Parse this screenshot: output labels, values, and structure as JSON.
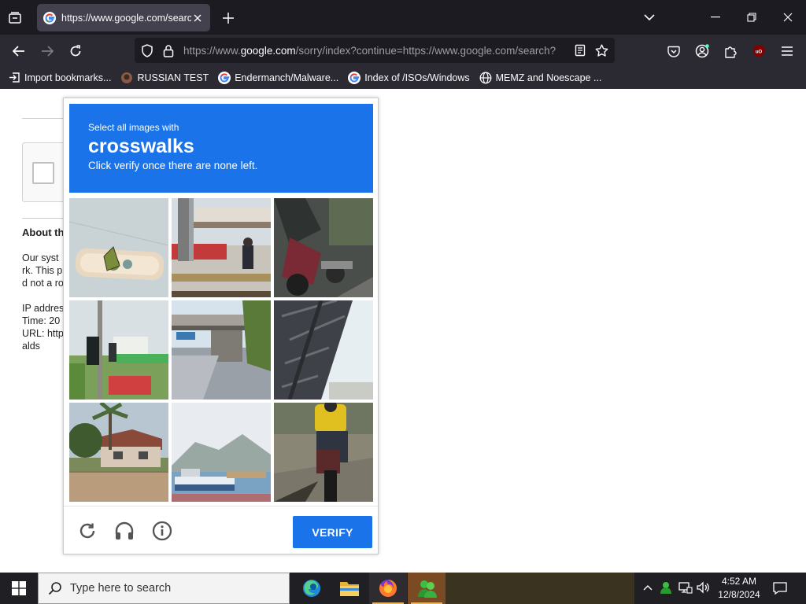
{
  "browser": {
    "tab": {
      "title": "https://www.google.com/search?q=",
      "favicon": "google-g-icon"
    },
    "url": {
      "prefix": "https://www.",
      "host": "google.com",
      "rest": "/sorry/index?continue=https://www.google.com/search?"
    },
    "bookmarks": [
      {
        "label": "Import bookmarks...",
        "icon": "import-icon"
      },
      {
        "label": "RUSSIAN TEST",
        "icon": "bookmark-icon"
      },
      {
        "label": "Endermanch/Malware...",
        "icon": "google-g-icon"
      },
      {
        "label": "Index of /ISOs/Windows",
        "icon": "google-g-icon"
      },
      {
        "label": "MEMZ and Noescape ...",
        "icon": "globe-icon"
      }
    ]
  },
  "page": {
    "about_title": "About th",
    "about_lines": [
      "Our syst",
      "rk. This p",
      "d not a ro",
      "",
      "IP addres",
      "Time: 20",
      "URL: http",
      "alds"
    ]
  },
  "challenge": {
    "instruction": "Select all images with",
    "target": "crosswalks",
    "subtext": "Click verify once there are none left.",
    "tiles": [
      "traffic light",
      "bus stop",
      "motorcycle",
      "traffic light",
      "bridge",
      "bridge",
      "house",
      "boat",
      "motorcycle"
    ],
    "verify_label": "VERIFY",
    "colors": {
      "accent": "#1a73e8"
    }
  },
  "taskbar": {
    "search_placeholder": "Type here to search",
    "time": "4:52 AM",
    "date": "12/8/2024"
  }
}
